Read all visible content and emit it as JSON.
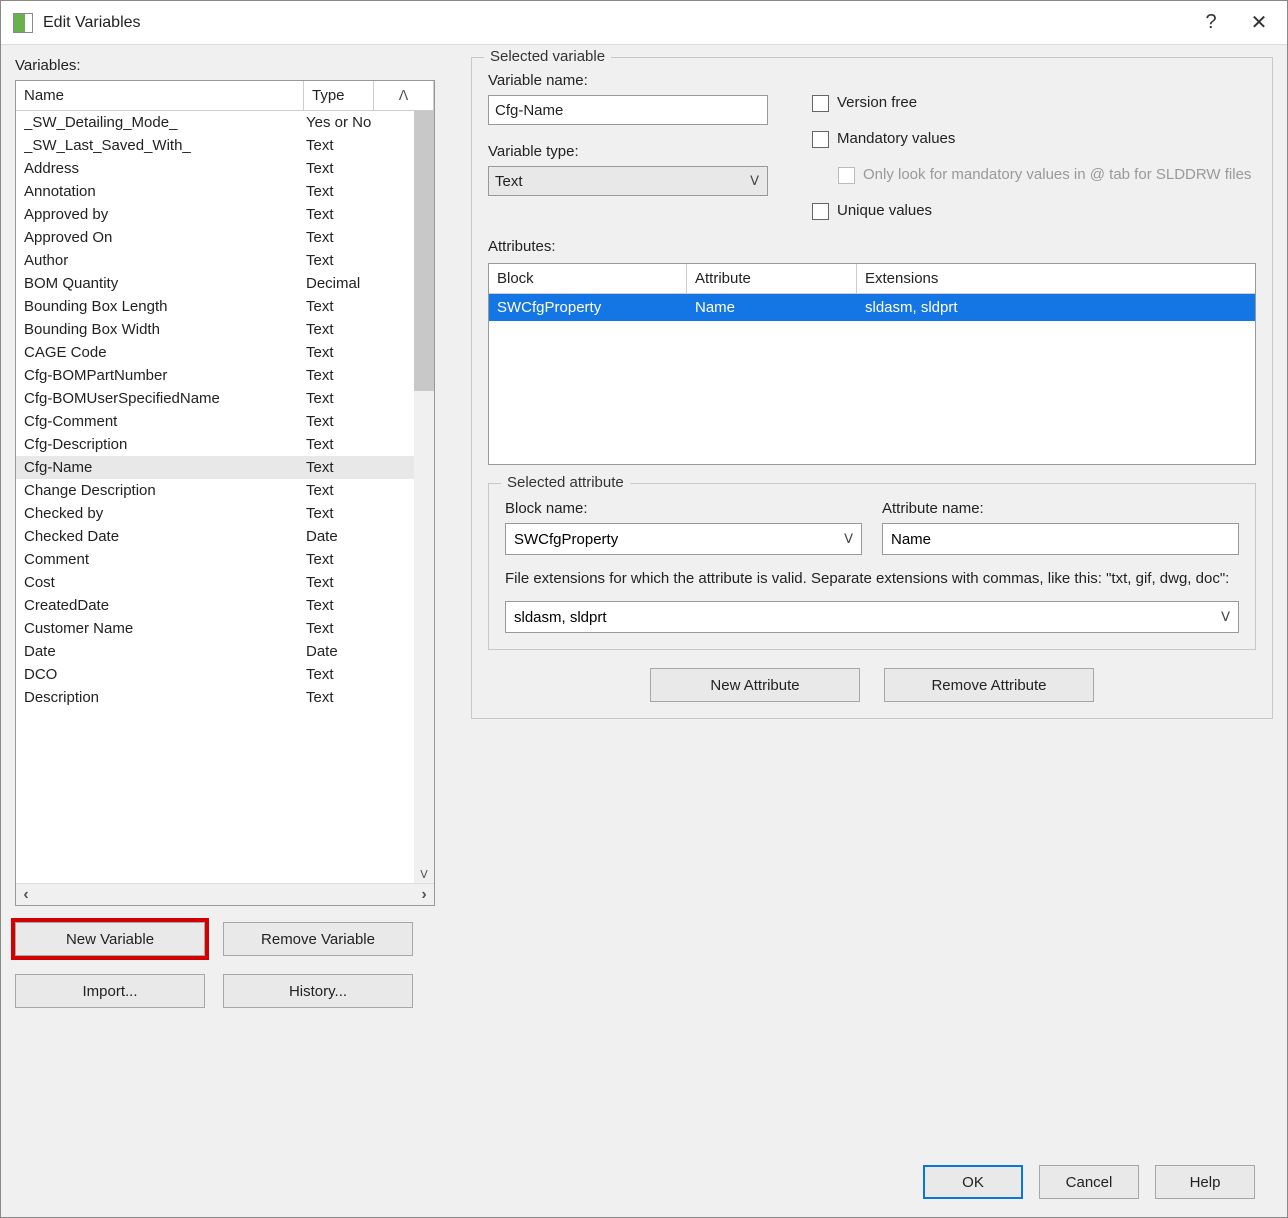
{
  "title": "Edit Variables",
  "left": {
    "label": "Variables:",
    "columns": {
      "name": "Name",
      "type": "Type"
    },
    "selected": "Cfg-Name",
    "items": [
      {
        "name": "_SW_Detailing_Mode_",
        "type": "Yes or No"
      },
      {
        "name": "_SW_Last_Saved_With_",
        "type": "Text"
      },
      {
        "name": "Address",
        "type": "Text"
      },
      {
        "name": "Annotation",
        "type": "Text"
      },
      {
        "name": "Approved by",
        "type": "Text"
      },
      {
        "name": "Approved On",
        "type": "Text"
      },
      {
        "name": "Author",
        "type": "Text"
      },
      {
        "name": "BOM Quantity",
        "type": "Decimal"
      },
      {
        "name": "Bounding Box Length",
        "type": "Text"
      },
      {
        "name": "Bounding Box Width",
        "type": "Text"
      },
      {
        "name": "CAGE Code",
        "type": "Text"
      },
      {
        "name": "Cfg-BOMPartNumber",
        "type": "Text"
      },
      {
        "name": "Cfg-BOMUserSpecifiedName",
        "type": "Text"
      },
      {
        "name": "Cfg-Comment",
        "type": "Text"
      },
      {
        "name": "Cfg-Description",
        "type": "Text"
      },
      {
        "name": "Cfg-Name",
        "type": "Text"
      },
      {
        "name": "Change Description",
        "type": "Text"
      },
      {
        "name": "Checked by",
        "type": "Text"
      },
      {
        "name": "Checked Date",
        "type": "Date"
      },
      {
        "name": "Comment",
        "type": "Text"
      },
      {
        "name": "Cost",
        "type": "Text"
      },
      {
        "name": "CreatedDate",
        "type": "Text"
      },
      {
        "name": "Customer Name",
        "type": "Text"
      },
      {
        "name": "Date",
        "type": "Date"
      },
      {
        "name": "DCO",
        "type": "Text"
      },
      {
        "name": "Description",
        "type": "Text"
      }
    ],
    "new_variable": "New Variable",
    "remove_variable": "Remove Variable",
    "import": "Import...",
    "history": "History..."
  },
  "selvar": {
    "group": "Selected variable",
    "name_label": "Variable name:",
    "name_value": "Cfg-Name",
    "type_label": "Variable type:",
    "type_value": "Text",
    "version_free": "Version free",
    "mandatory": "Mandatory values",
    "mandatory_sub": "Only look for mandatory values in @ tab for SLDDRW files",
    "unique": "Unique values"
  },
  "attributes": {
    "label": "Attributes:",
    "columns": {
      "block": "Block",
      "attribute": "Attribute",
      "extensions": "Extensions"
    },
    "rows": [
      {
        "block": "SWCfgProperty",
        "attribute": "Name",
        "extensions": "sldasm, sldprt"
      }
    ]
  },
  "selattr": {
    "group": "Selected attribute",
    "block_label": "Block name:",
    "block_value": "SWCfgProperty",
    "attr_label": "Attribute name:",
    "attr_value": "Name",
    "desc": "File extensions for which the attribute is valid. Separate extensions with commas, like this: \"txt, gif, dwg, doc\":",
    "ext_value": "sldasm, sldprt",
    "new_attr": "New Attribute",
    "remove_attr": "Remove Attribute"
  },
  "footer": {
    "ok": "OK",
    "cancel": "Cancel",
    "help": "Help"
  }
}
